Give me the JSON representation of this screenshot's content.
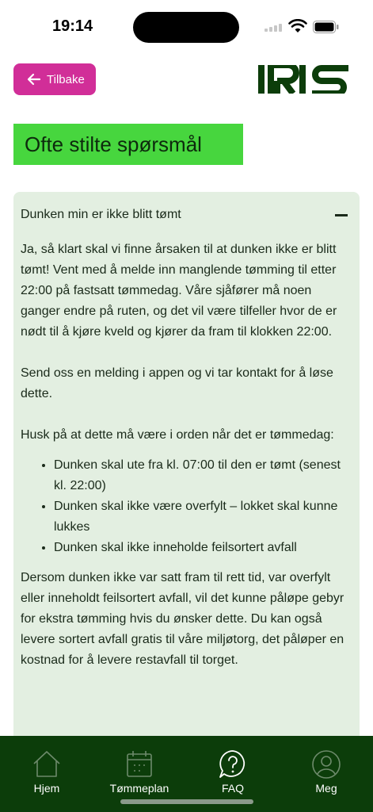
{
  "status_bar": {
    "time": "19:14"
  },
  "header": {
    "back_label": "Tilbake",
    "logo_text": "IRIS",
    "brand_color": "#0c3d0a",
    "accent_color": "#d12e98"
  },
  "page": {
    "title": "Ofte stilte spørsmål",
    "title_bg": "#47d63e"
  },
  "faq": {
    "question": "Dunken min er ikke blitt tømt",
    "expanded": true,
    "paragraphs": [
      "Ja, så klart skal vi finne årsaken til at dunken ikke er blitt tømt! Vent med å melde inn manglende tømming til etter 22:00 på fastsatt tømmedag. Våre sjåfører må noen ganger endre på ruten, og det vil være tilfeller hvor de er nødt til å kjøre kveld og kjører da fram til klokken 22:00.",
      "Send oss en melding i appen og vi tar kontakt for å løse dette.",
      "Husk på at dette må være i orden når det er tømmedag:"
    ],
    "bullets": [
      "Dunken skal ute fra kl. 07:00 til den er tømt (senest kl. 22:00)",
      "Dunken skal ikke være overfylt – lokket skal kunne lukkes",
      "Dunken skal ikke inneholde feilsortert avfall"
    ],
    "closing": "Dersom dunken ikke var satt fram til rett tid, var overfylt eller inneholdt feilsortert avfall, vil det kunne påløpe gebyr for ekstra tømming hvis du ønsker dette. Du kan også levere sortert avfall gratis til våre miljøtorg, det påløper en kostnad for å levere restavfall til torget."
  },
  "tabs": [
    {
      "label": "Hjem",
      "icon": "home-icon"
    },
    {
      "label": "Tømmeplan",
      "icon": "calendar-icon"
    },
    {
      "label": "FAQ",
      "icon": "question-icon"
    },
    {
      "label": "Meg",
      "icon": "profile-icon"
    }
  ]
}
